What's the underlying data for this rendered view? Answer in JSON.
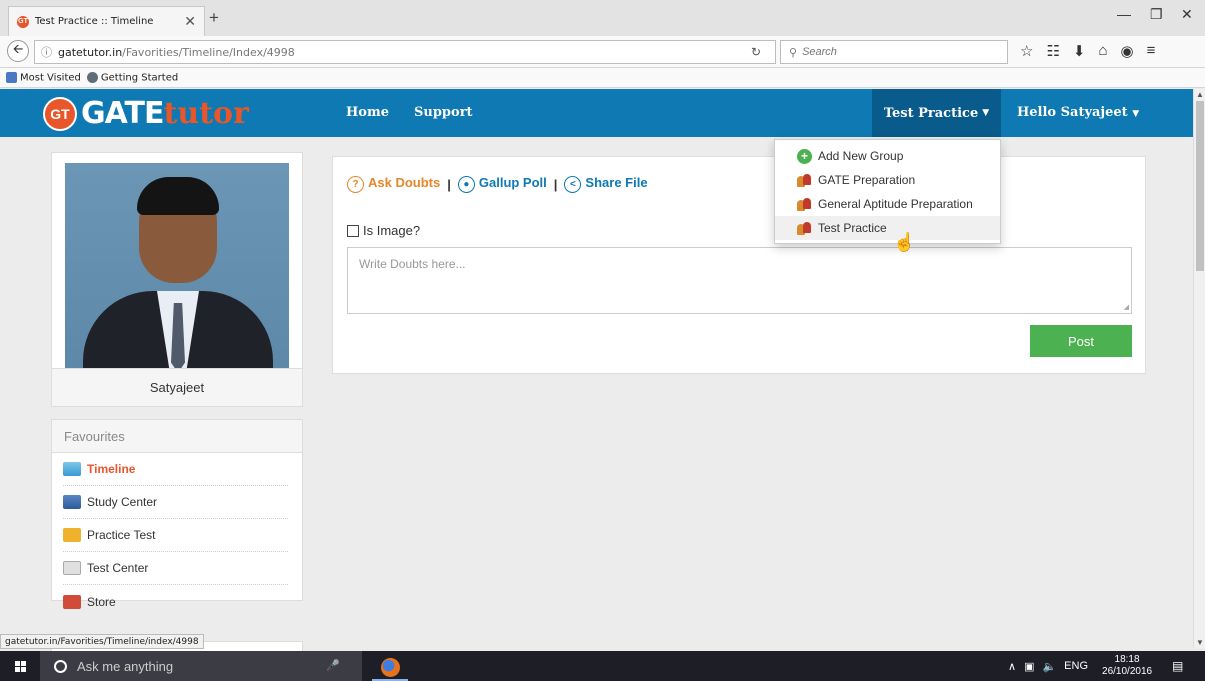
{
  "browser": {
    "tab_title": "Test Practice :: Timeline",
    "tab_close": "✕",
    "new_tab": "+",
    "url_host": "gatetutor.in",
    "url_path": "/Favorities/Timeline/Index/4998",
    "search_placeholder": "Search",
    "bookmarks": [
      "Most Visited",
      "Getting Started"
    ],
    "status_url": "gatetutor.in/Favorities/Timeline/index/4998",
    "icons": [
      "back-icon",
      "info-icon",
      "reload-icon",
      "search-icon",
      "star-icon",
      "reading-list-icon",
      "download-icon",
      "home-icon",
      "pocket-icon",
      "menu-icon"
    ]
  },
  "site": {
    "logo_badge": "GT",
    "logo_gate": "GATE",
    "logo_tutor": "tutor",
    "nav": {
      "home": "Home",
      "support": "Support",
      "test_practice": "Test Practice",
      "user": "Hello Satyajeet"
    },
    "brand_color": "#0e79b2",
    "accent_color": "#e8562a"
  },
  "dropdown": {
    "items": [
      "Add New Group",
      "GATE Preparation",
      "General Aptitude Preparation",
      "Test Practice"
    ]
  },
  "profile": {
    "name": "Satyajeet"
  },
  "favourites": {
    "title": "Favourites",
    "items": [
      "Timeline",
      "Study Center",
      "Practice Test",
      "Test Center",
      "Store"
    ]
  },
  "post": {
    "ask_doubts": "Ask Doubts",
    "gallup_poll": "Gallup Poll",
    "share_file": "Share File",
    "separator": "|",
    "is_image": "Is Image?",
    "placeholder": "Write Doubts here...",
    "post_button": "Post",
    "post_color": "#4cb150"
  },
  "taskbar": {
    "search_text": "Ask me anything",
    "lang": "ENG",
    "time": "18:18",
    "date": "26/10/2016"
  }
}
